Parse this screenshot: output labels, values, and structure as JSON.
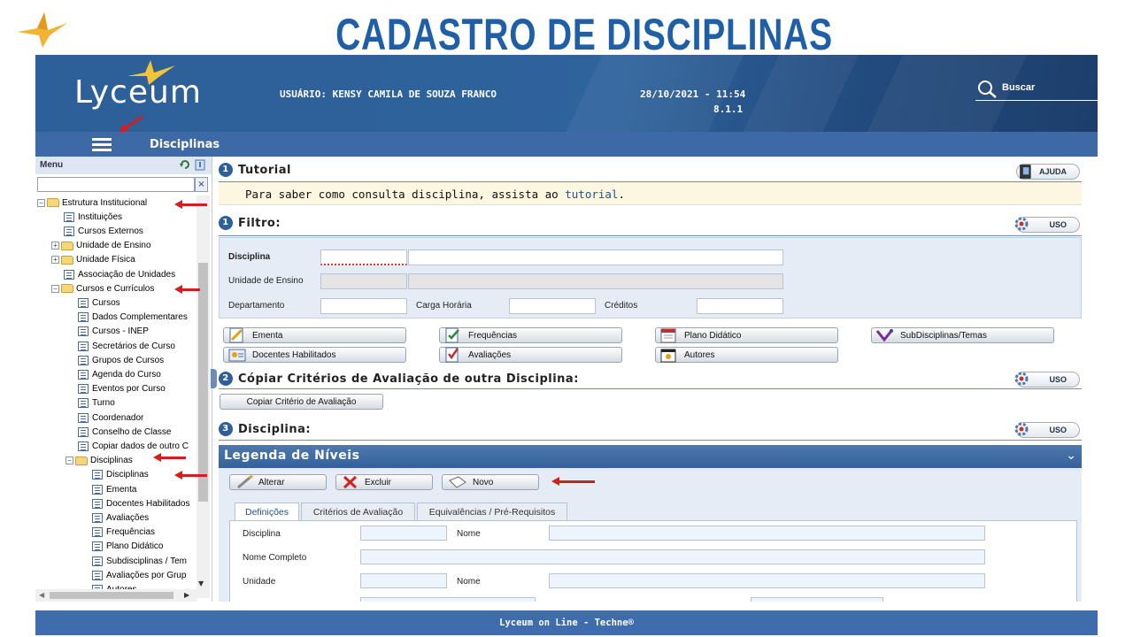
{
  "slide": {
    "title": "CADASTRO DE DISCIPLINAS"
  },
  "header": {
    "logo": "Lyceum",
    "user_label": "USUÁRIO: KENSY CAMILA DE SOUZA FRANCO",
    "datetime": "28/10/2021 - 11:54",
    "version": "8.1.1",
    "search_label": "Buscar"
  },
  "subbar": {
    "page_name": "Disciplinas"
  },
  "sidebar": {
    "title": "Menu",
    "clear": "×",
    "items": [
      {
        "label": "Estrutura Institucional",
        "type": "folder",
        "toggle": "−"
      },
      {
        "label": "Instituições",
        "type": "doc"
      },
      {
        "label": "Cursos Externos",
        "type": "doc"
      },
      {
        "label": "Unidade de Ensino",
        "type": "folder",
        "toggle": "+"
      },
      {
        "label": "Unidade Física",
        "type": "folder",
        "toggle": "+"
      },
      {
        "label": "Associação de Unidades",
        "type": "doc"
      },
      {
        "label": "Cursos e Currículos",
        "type": "folder",
        "toggle": "−"
      },
      {
        "label": "Cursos",
        "type": "doc"
      },
      {
        "label": "Dados Complementares",
        "type": "doc"
      },
      {
        "label": "Cursos - INEP",
        "type": "doc"
      },
      {
        "label": "Secretários de Curso",
        "type": "doc"
      },
      {
        "label": "Grupos de Cursos",
        "type": "doc"
      },
      {
        "label": "Agenda do Curso",
        "type": "doc"
      },
      {
        "label": "Eventos por Curso",
        "type": "doc"
      },
      {
        "label": "Turno",
        "type": "doc"
      },
      {
        "label": "Coordenador",
        "type": "doc"
      },
      {
        "label": "Conselho de Classe",
        "type": "doc"
      },
      {
        "label": "Copiar dados de outro C",
        "type": "doc"
      },
      {
        "label": "Disciplinas",
        "type": "folder",
        "toggle": "−"
      },
      {
        "label": "Disciplinas",
        "type": "doc"
      },
      {
        "label": "Ementa",
        "type": "doc"
      },
      {
        "label": "Docentes Habilitados",
        "type": "doc"
      },
      {
        "label": "Avaliações",
        "type": "doc"
      },
      {
        "label": "Frequências",
        "type": "doc"
      },
      {
        "label": "Plano Didático",
        "type": "doc"
      },
      {
        "label": "Subdisciplinas / Tem",
        "type": "doc"
      },
      {
        "label": "Avaliações por Grup",
        "type": "doc"
      },
      {
        "label": "Autores",
        "type": "doc"
      }
    ]
  },
  "tutorial": {
    "number": "1",
    "title": "Tutorial",
    "help_label": "AJUDA",
    "text": "Para saber como consulta disciplina, assista ao",
    "link": "tutorial",
    "period": "."
  },
  "filter": {
    "number": "1",
    "title": "Filtro:",
    "uso_label": "USO",
    "disciplina_label": "Disciplina",
    "unidade_label": "Unidade de Ensino",
    "departamento_label": "Departamento",
    "carga_label": "Carga Horária",
    "creditos_label": "Créditos"
  },
  "actions": {
    "ementa": "Ementa",
    "frequencias": "Frequências",
    "plano": "Plano Didático",
    "subdisciplinas": "SubDisciplinas/Temas",
    "docentes": "Docentes Habilitados",
    "avaliacoes": "Avaliações",
    "autores": "Autores"
  },
  "copy_section": {
    "number": "2",
    "title": "Cópiar Critérios de Avaliação de outra Disciplina:",
    "uso_label": "USO",
    "button": "Copiar Critério de Avaliação"
  },
  "disciplina_section": {
    "number": "3",
    "title": "Disciplina:",
    "uso_label": "USO",
    "legend": "Legenda de Níveis",
    "alterar": "Alterar",
    "excluir": "Excluir",
    "novo": "Novo",
    "tabs": [
      "Definições",
      "Critérios de Avaliação",
      "Equivalências / Pré-Requisitos"
    ],
    "disciplina_label": "Disciplina",
    "nome_label": "Nome",
    "nome_completo_label": "Nome Completo",
    "unidade_label": "Unidade",
    "nome2_label": "Nome"
  },
  "footer": {
    "text": "Lyceum on Line - Techne®"
  },
  "colors": {
    "header": "#2f639c",
    "accent": "#1e5fa8",
    "arrow": "#d61d1d"
  }
}
